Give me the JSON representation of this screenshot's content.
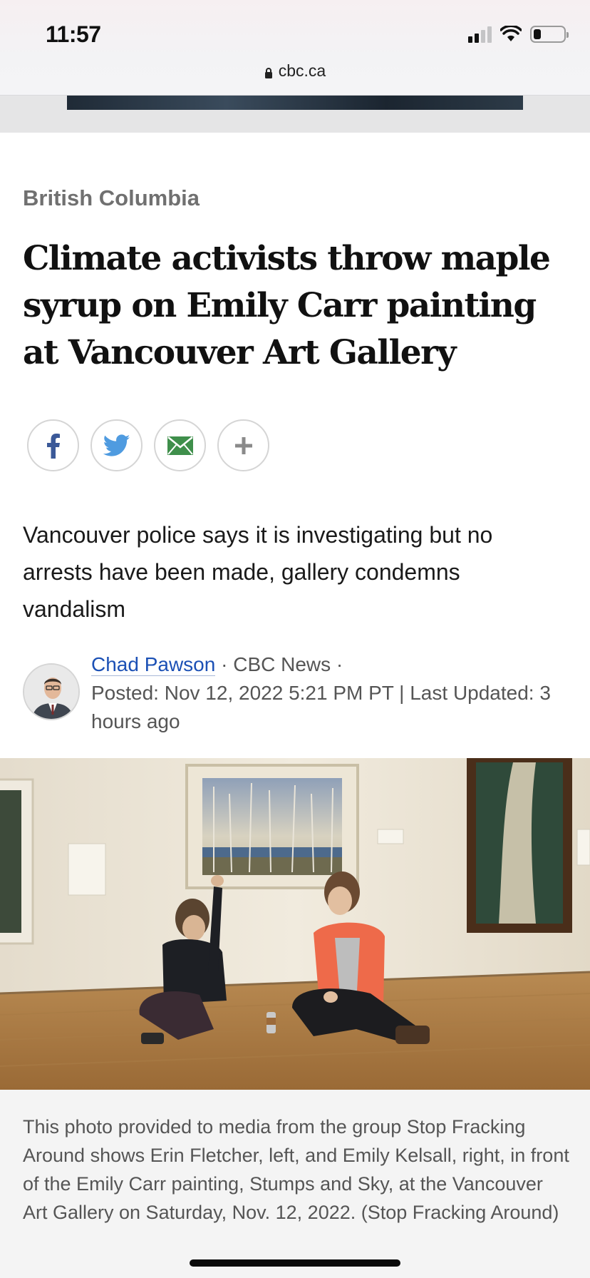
{
  "status_bar": {
    "time": "11:57",
    "icons": [
      "cellular-signal-icon",
      "wifi-icon",
      "battery-icon"
    ]
  },
  "browser": {
    "url": "cbc.ca",
    "lock_icon": "lock-icon"
  },
  "article": {
    "section": "British Columbia",
    "headline": "Climate activists throw maple syrup on Emily Carr painting at Vancouver Art Gallery",
    "share_buttons": [
      {
        "name": "facebook",
        "icon": "facebook-icon"
      },
      {
        "name": "twitter",
        "icon": "twitter-icon"
      },
      {
        "name": "email",
        "icon": "email-icon"
      },
      {
        "name": "more",
        "icon": "plus-icon"
      }
    ],
    "deck": "Vancouver police says it is investigating but no arrests have been made, gallery condemns vandalism",
    "byline": {
      "author": "Chad Pawson",
      "outlet_sep_1": " · ",
      "outlet": "CBC News",
      "outlet_sep_2": " ·",
      "posted": "Posted: Nov 12, 2022 5:21 PM PT | Last Updated: 3 hours ago"
    },
    "photo_caption": "This photo provided to media from the group Stop Fracking Around shows Erin Fletcher, left, and Emily Kelsall, right, in front of the Emily Carr painting, Stumps and Sky, at the Vancouver Art Gallery on Saturday, Nov. 12, 2022. (Stop Fracking Around)"
  },
  "colors": {
    "link": "#1b50b5",
    "facebook": "#3b5998",
    "twitter": "#4f9be0",
    "email": "#3f8f4b",
    "section": "#707070"
  }
}
